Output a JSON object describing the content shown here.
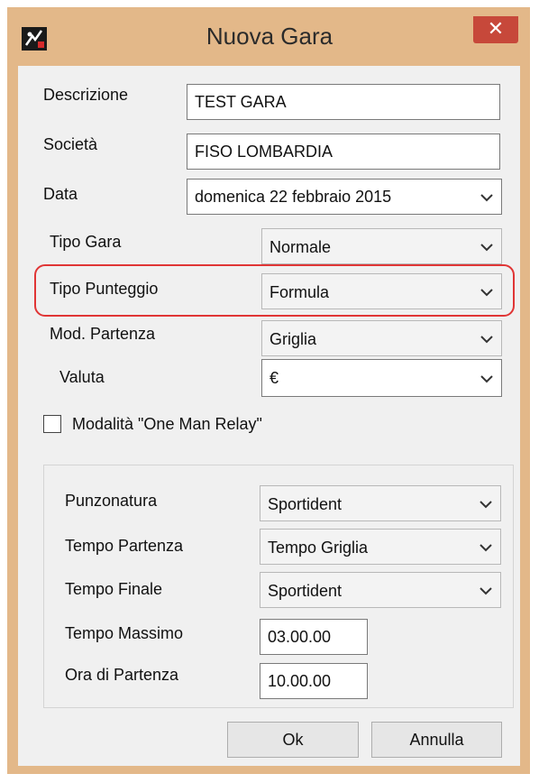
{
  "window": {
    "title": "Nuova Gara",
    "close_glyph": "✕",
    "icon": "app-logo-icon",
    "frame_color": "#e3b889",
    "close_color": "#c7483a"
  },
  "form": {
    "descrizione": {
      "label": "Descrizione",
      "value": "TEST GARA"
    },
    "societa": {
      "label": "Società",
      "value": "FISO LOMBARDIA"
    },
    "data": {
      "label": "Data",
      "value": "domenica 22  febbraio  2015"
    },
    "tipo_gara": {
      "label": "Tipo Gara",
      "value": "Normale"
    },
    "tipo_punteggio": {
      "label": "Tipo Punteggio",
      "value": "Formula"
    },
    "mod_partenza": {
      "label": "Mod. Partenza",
      "value": "Griglia"
    },
    "valuta": {
      "label": "Valuta",
      "value": "€"
    },
    "one_man_relay": {
      "label": "Modalità \"One Man Relay\"",
      "checked": false
    }
  },
  "group": {
    "punzonatura": {
      "label": "Punzonatura",
      "value": "Sportident"
    },
    "tempo_partenza": {
      "label": "Tempo Partenza",
      "value": "Tempo Griglia"
    },
    "tempo_finale": {
      "label": "Tempo Finale",
      "value": "Sportident"
    },
    "tempo_massimo": {
      "label": "Tempo Massimo",
      "value": "03.00.00"
    },
    "ora_partenza": {
      "label": "Ora di Partenza",
      "value": "10.00.00"
    }
  },
  "buttons": {
    "ok": "Ok",
    "annulla": "Annulla"
  },
  "highlight_color": "#e03535"
}
